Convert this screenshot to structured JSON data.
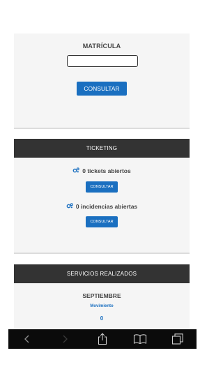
{
  "matricula": {
    "label": "MATRÍCULA",
    "input_value": "",
    "button_label": "CONSULTAR"
  },
  "ticketing": {
    "header": "TICKETING",
    "tickets_text": "0 tickets abiertos",
    "tickets_button": "CONSULTAR",
    "incidencias_text": "0 incidencias abiertas",
    "incidencias_button": "CONSULTAR",
    "icon": "cogs-icon"
  },
  "servicios": {
    "header": "SERVICIOS REALIZADOS",
    "month": "SEPTIEMBRE",
    "movimiento_label": "Movimiento",
    "movimiento_value": "0"
  },
  "toolbar": {
    "icons": [
      "back-icon",
      "forward-icon",
      "share-icon",
      "bookmarks-icon",
      "tabs-icon"
    ]
  },
  "colors": {
    "accent": "#1a6fc0",
    "header_bg": "#333333",
    "card_bg": "#f5f5f5",
    "toolbar_bg": "#0b0b0b"
  }
}
